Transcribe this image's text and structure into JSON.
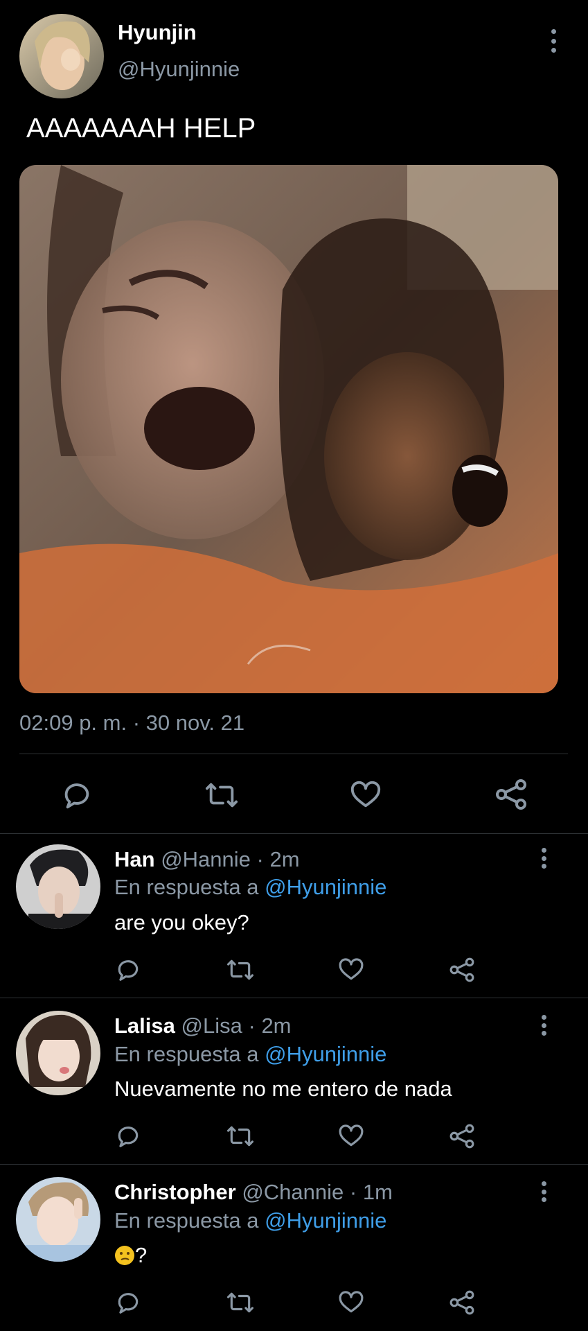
{
  "tweet": {
    "author_name": "Hyunjin",
    "author_handle": "@Hyunjinnie",
    "text": "AAAAAAAH HELP",
    "timestamp": "02:09 p. m. · 30 nov. 21",
    "image_description_icon": "photo"
  },
  "action_icons": [
    "reply-icon",
    "retweet-icon",
    "like-icon",
    "share-icon"
  ],
  "replies": [
    {
      "name": "Han",
      "handle": "@Hannie",
      "time": "2m",
      "in_reply_prefix": "En respuesta a",
      "in_reply_handle": "@Hyunjinnie",
      "text": "are you okey?"
    },
    {
      "name": "Lalisa",
      "handle": "@Lisa",
      "time": "2m",
      "in_reply_prefix": "En respuesta a",
      "in_reply_handle": "@Hyunjinnie",
      "text": "Nuevamente no me entero de nada"
    },
    {
      "name": "Christopher",
      "handle": "@Channie",
      "time": "1m",
      "in_reply_prefix": "En respuesta a",
      "in_reply_handle": "@Hyunjinnie",
      "text": "?"
    }
  ],
  "colors": {
    "background": "#000000",
    "secondary_text": "#8b98a5",
    "link": "#3f9ee8",
    "divider": "#2f3336"
  }
}
